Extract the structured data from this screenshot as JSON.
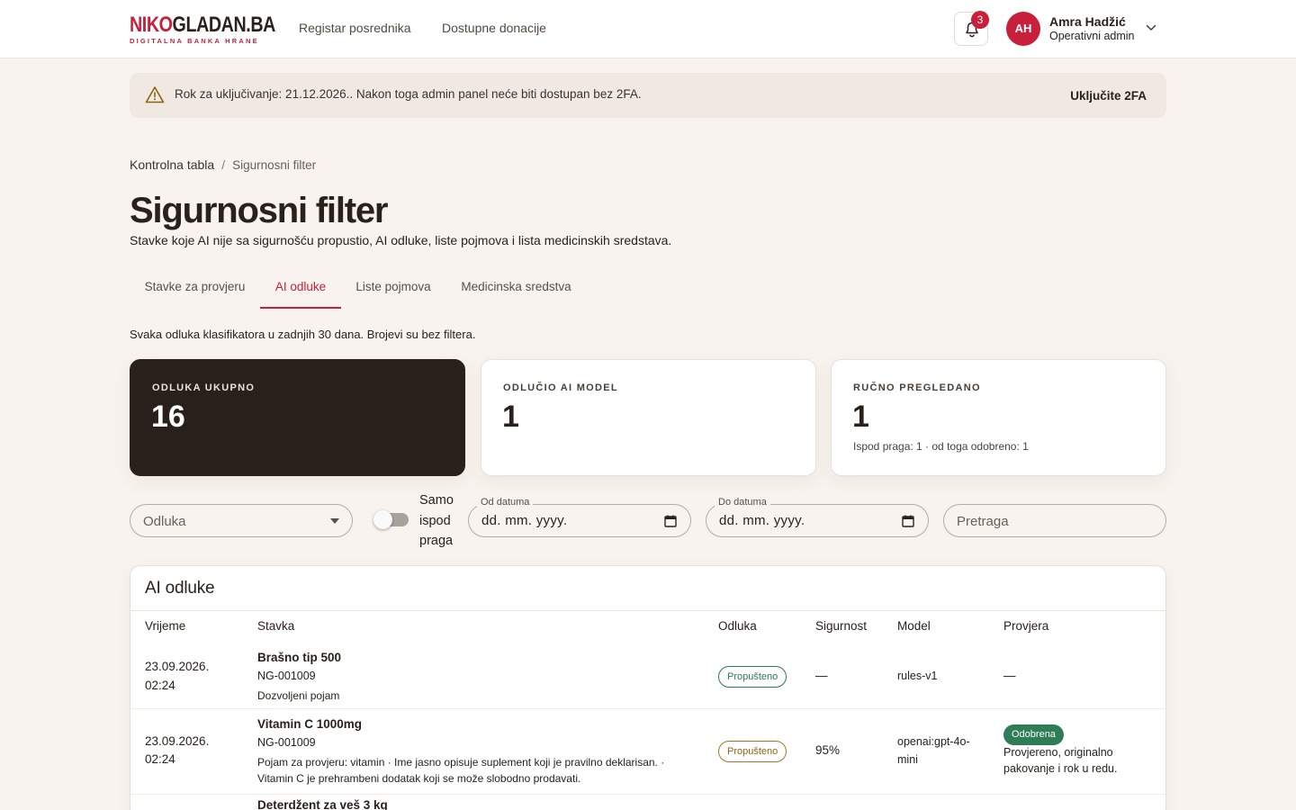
{
  "header": {
    "logo_main_a": "NIKO",
    "logo_main_b": "GLADAN.BA",
    "logo_sub": "DIGITALNA BANKA HRANE",
    "nav": [
      "Registar posrednika",
      "Dostupne donacije"
    ],
    "notification_count": "3",
    "user": {
      "initials": "AH",
      "name": "Amra Hadžić",
      "role": "Operativni admin"
    }
  },
  "banner": {
    "text": "Rok za uključivanje: 21.12.2026.. Nakon toga admin panel neće biti dostupan bez 2FA.",
    "action": "Uključite 2FA"
  },
  "breadcrumb": {
    "parent": "Kontrolna tabla",
    "separator": "/",
    "current": "Sigurnosni filter"
  },
  "page": {
    "title": "Sigurnosni filter",
    "subtitle": "Stavke koje AI nije sa sigurnošću propustio, AI odluke, liste pojmova i lista medicinskih sredstava."
  },
  "tabs": [
    {
      "label": "Stavke za provjeru",
      "active": false
    },
    {
      "label": "AI odluke",
      "active": true
    },
    {
      "label": "Liste pojmova",
      "active": false
    },
    {
      "label": "Medicinska sredstva",
      "active": false
    }
  ],
  "description": "Svaka odluka klasifikatora u zadnjih 30 dana. Brojevi su bez filtera.",
  "stats": [
    {
      "label": "ODLUKA UKUPNO",
      "value": "16",
      "note": ""
    },
    {
      "label": "ODLUČIO AI MODEL",
      "value": "1",
      "note": ""
    },
    {
      "label": "RUČNO PREGLEDANO",
      "value": "1",
      "note": "Ispod praga: 1 · od toga odobreno: 1"
    }
  ],
  "filters": {
    "decision_placeholder": "Odluka",
    "toggle_label": "Samo ispod praga",
    "toggle_on": false,
    "date_from_label": "Od datuma",
    "date_from_value": "dd. mm. yyyy.",
    "date_to_label": "Do datuma",
    "date_to_value": "dd. mm. yyyy.",
    "search_placeholder": "Pretraga"
  },
  "table": {
    "title": "AI odluke",
    "columns": [
      "Vrijeme",
      "Stavka",
      "Odluka",
      "Sigurnost",
      "Model",
      "Provjera"
    ],
    "rows": [
      {
        "time_date": "23.09.2026.",
        "time_clock": "02:24",
        "item_name": "Brašno tip 500",
        "item_code": "NG-001009",
        "item_note_1": "Dozvoljeni pojam",
        "item_note_2": "",
        "decision": "Propušteno",
        "confidence": "—",
        "model_1": "rules-v1",
        "model_2": "",
        "review_badge": "",
        "review_text_1": "—",
        "review_text_2": ""
      },
      {
        "time_date": "23.09.2026.",
        "time_clock": "02:24",
        "item_name": "Vitamin C 1000mg",
        "item_code": "NG-001009",
        "item_note_1": "Pojam za provjeru: vitamin · Ime jasno opisuje suplement koji je pravilno deklarisan. ·",
        "item_note_2": "Vitamin C je prehrambeni dodatak koji se može slobodno prodavati.",
        "decision": "Propušteno",
        "confidence": "95%",
        "model_1": "openai:gpt-4o-",
        "model_2": "mini",
        "review_badge": "Odobrena",
        "review_text_1": "Provjereno, originalno",
        "review_text_2": "pakovanje i rok u redu."
      },
      {
        "item_name": "Deterdžent za veš 3 kg"
      }
    ]
  }
}
